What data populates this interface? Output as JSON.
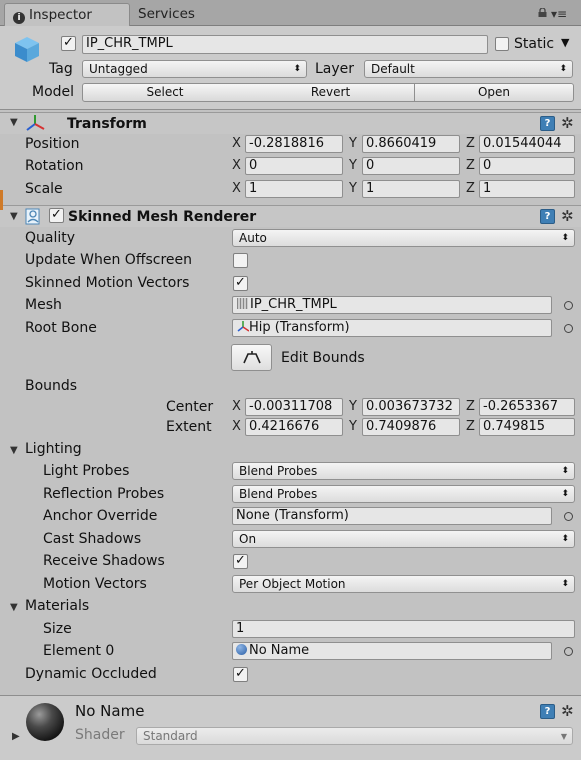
{
  "tabs": {
    "inspector": "Inspector",
    "services": "Services"
  },
  "header": {
    "object_name": "IP_CHR_TMPL",
    "static_label": "Static",
    "tag_label": "Tag",
    "tag_value": "Untagged",
    "layer_label": "Layer",
    "layer_value": "Default",
    "model_label": "Model",
    "buttons": {
      "select": "Select",
      "revert": "Revert",
      "open": "Open"
    }
  },
  "transform": {
    "title": "Transform",
    "rows": [
      {
        "label": "Position",
        "x": "-0.2818816",
        "y": "0.8660419",
        "z": "0.01544044"
      },
      {
        "label": "Rotation",
        "x": "0",
        "y": "0",
        "z": "0"
      },
      {
        "label": "Scale",
        "x": "1",
        "y": "1",
        "z": "1"
      }
    ]
  },
  "axis": {
    "x": "X",
    "y": "Y",
    "z": "Z"
  },
  "renderer": {
    "title": "Skinned Mesh Renderer",
    "quality_label": "Quality",
    "quality_value": "Auto",
    "update_offscreen_label": "Update When Offscreen",
    "update_offscreen": false,
    "motion_vectors_label": "Skinned Motion Vectors",
    "motion_vectors": true,
    "mesh_label": "Mesh",
    "mesh_value": "IP_CHR_TMPL",
    "root_bone_label": "Root Bone",
    "root_bone_value": "Hip (Transform)",
    "edit_bounds": "Edit Bounds",
    "bounds_label": "Bounds",
    "center_label": "Center",
    "center": {
      "x": "-0.00311708",
      "y": "0.003673732",
      "z": "-0.2653367"
    },
    "extent_label": "Extent",
    "extent": {
      "x": "0.4216676",
      "y": "0.7409876",
      "z": "0.749815"
    },
    "lighting_label": "Lighting",
    "light_probes_label": "Light Probes",
    "light_probes_value": "Blend Probes",
    "reflection_probes_label": "Reflection Probes",
    "reflection_probes_value": "Blend Probes",
    "anchor_override_label": "Anchor Override",
    "anchor_override_value": "None (Transform)",
    "cast_shadows_label": "Cast Shadows",
    "cast_shadows_value": "On",
    "receive_shadows_label": "Receive Shadows",
    "receive_shadows": true,
    "motion_vectors2_label": "Motion Vectors",
    "motion_vectors2_value": "Per Object Motion",
    "materials_label": "Materials",
    "size_label": "Size",
    "size_value": "1",
    "element0_label": "Element 0",
    "element0_value": "No Name",
    "dynamic_occluded_label": "Dynamic Occluded",
    "dynamic_occluded": true
  },
  "material": {
    "name": "No Name",
    "shader_label": "Shader",
    "shader_value": "Standard"
  },
  "icons": {
    "help": "?",
    "gear": "✲",
    "check": "✓",
    "dropdown_arrow": "⬍"
  }
}
